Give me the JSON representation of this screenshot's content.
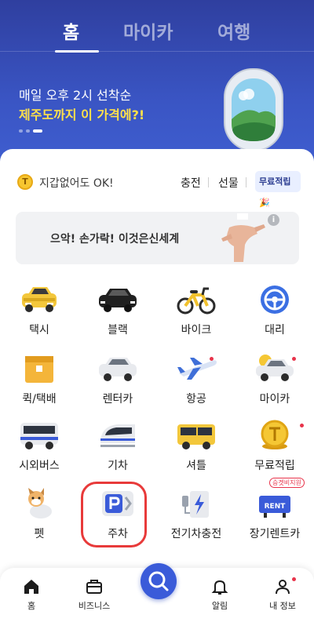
{
  "top_tabs": [
    {
      "label": "홈",
      "active": true
    },
    {
      "label": "마이카",
      "active": false
    },
    {
      "label": "여행",
      "active": false
    }
  ],
  "promo": {
    "line1": "매일 오후 2시 선착순",
    "line2": "제주도까지 이 가격에?!",
    "highlight_color": "#ffe14a"
  },
  "wallet": {
    "coin_icon": "coin-icon",
    "coin_glyph": "T",
    "text": "지갑없어도 OK!",
    "charge_label": "충전",
    "gift_label": "선물",
    "free_label": "무료적립",
    "free_emoji": "🎉"
  },
  "ad": {
    "text": "으악! 손가락! 이것은신세계",
    "info_glyph": "i"
  },
  "services": [
    {
      "label": "택시",
      "icon": "taxi-icon"
    },
    {
      "label": "블랙",
      "icon": "black-car-icon"
    },
    {
      "label": "바이크",
      "icon": "bike-icon"
    },
    {
      "label": "대리",
      "icon": "steering-wheel-icon"
    },
    {
      "label": "퀵/택배",
      "icon": "box-icon"
    },
    {
      "label": "렌터카",
      "icon": "rental-car-icon"
    },
    {
      "label": "항공",
      "icon": "airplane-icon",
      "dot": true
    },
    {
      "label": "마이카",
      "icon": "my-car-icon",
      "dot": true
    },
    {
      "label": "시외버스",
      "icon": "bus-icon"
    },
    {
      "label": "기차",
      "icon": "train-icon"
    },
    {
      "label": "셔틀",
      "icon": "shuttle-icon"
    },
    {
      "label": "무료적립",
      "icon": "coin-icon",
      "dot": true
    },
    {
      "label": "펫",
      "icon": "dog-icon"
    },
    {
      "label": "주차",
      "icon": "parking-icon",
      "highlighted": true
    },
    {
      "label": "전기차충전",
      "icon": "ev-charger-icon"
    },
    {
      "label": "장기렌트카",
      "icon": "rent-car-icon",
      "badge": "승겟비지원",
      "sign": "RENT"
    }
  ],
  "bottom_nav": [
    {
      "label": "홈",
      "icon": "home-icon"
    },
    {
      "label": "비즈니스",
      "icon": "briefcase-icon"
    },
    {
      "label": "알림",
      "icon": "bell-icon"
    },
    {
      "label": "내 정보",
      "icon": "user-icon",
      "dot": true
    }
  ],
  "search_fab_icon": "search-icon",
  "colors": {
    "brand": "#3a5bd9",
    "notification_dot": "#e8334a",
    "highlight_ring": "#e83a3a"
  }
}
